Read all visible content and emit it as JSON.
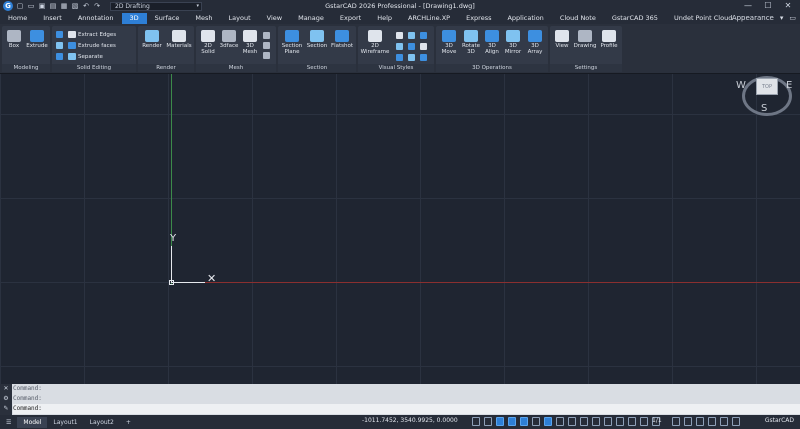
{
  "app": {
    "logo_letter": "G",
    "title": "GstarCAD 2026 Professional - [Drawing1.dwg]",
    "workspace": "2D Drafting",
    "window_controls": [
      "—",
      "☐",
      "✕"
    ]
  },
  "menu": {
    "tabs": [
      "Home",
      "Insert",
      "Annotation",
      "3D",
      "Surface",
      "Mesh",
      "Layout",
      "View",
      "Manage",
      "Export",
      "Help",
      "ARCHLine.XP",
      "Express",
      "Application",
      "Cloud Note",
      "GstarCAD 365",
      "Undet Point Cloud"
    ],
    "active": "3D",
    "appearance": "Appearance",
    "caret": "▾"
  },
  "ribbon": {
    "modeling": {
      "label": "Modeling",
      "box": "Box",
      "extrude": "Extrude"
    },
    "solid_editing": {
      "label": "Solid Editing",
      "extract_edges": "Extract Edges",
      "extrude_faces": "Extrude faces",
      "separate": "Separate"
    },
    "render": {
      "label": "Render",
      "render": "Render",
      "materials": "Materials"
    },
    "mesh": {
      "label": "Mesh",
      "solid2d": "2D Solid",
      "face3d": "3dface",
      "mesh3d": "3D Mesh"
    },
    "section": {
      "label": "Section",
      "section_plane": "Section Plane",
      "section": "Section",
      "flatshot": "Flatshot"
    },
    "visual_styles": {
      "label": "Visual Styles",
      "wireframe2d": "2D Wireframe"
    },
    "operations": {
      "label": "3D Operations",
      "move3d": "3D Move",
      "rotate3d": "Rotate 3D",
      "align3d": "3D Align",
      "mirror3d": "3D Mirror",
      "array3d": "3D Array"
    },
    "settings": {
      "label": "Settings",
      "view": "View",
      "drawing": "Drawing",
      "profile": "Profile"
    }
  },
  "canvas": {
    "ucs_y": "Y",
    "ucs_x": "✕",
    "viewcube": {
      "top": "TOP",
      "west": "W",
      "east": "E",
      "south": "S"
    }
  },
  "command": {
    "history": [
      "Command:",
      "Command:"
    ],
    "prompt": "Command:"
  },
  "status": {
    "layouts": [
      "Model",
      "Layout1",
      "Layout2"
    ],
    "active_layout": "Model",
    "add_layout": "+",
    "coordinates": "-1011.7452, 3540.9925, 0.0000",
    "scale": "1/1",
    "brand": "GstarCAD"
  },
  "colors": {
    "accent": "#2e7fd6",
    "x_axis": "#8a2f2f",
    "y_axis": "#3c8a4a",
    "canvas": "#1f2531"
  }
}
